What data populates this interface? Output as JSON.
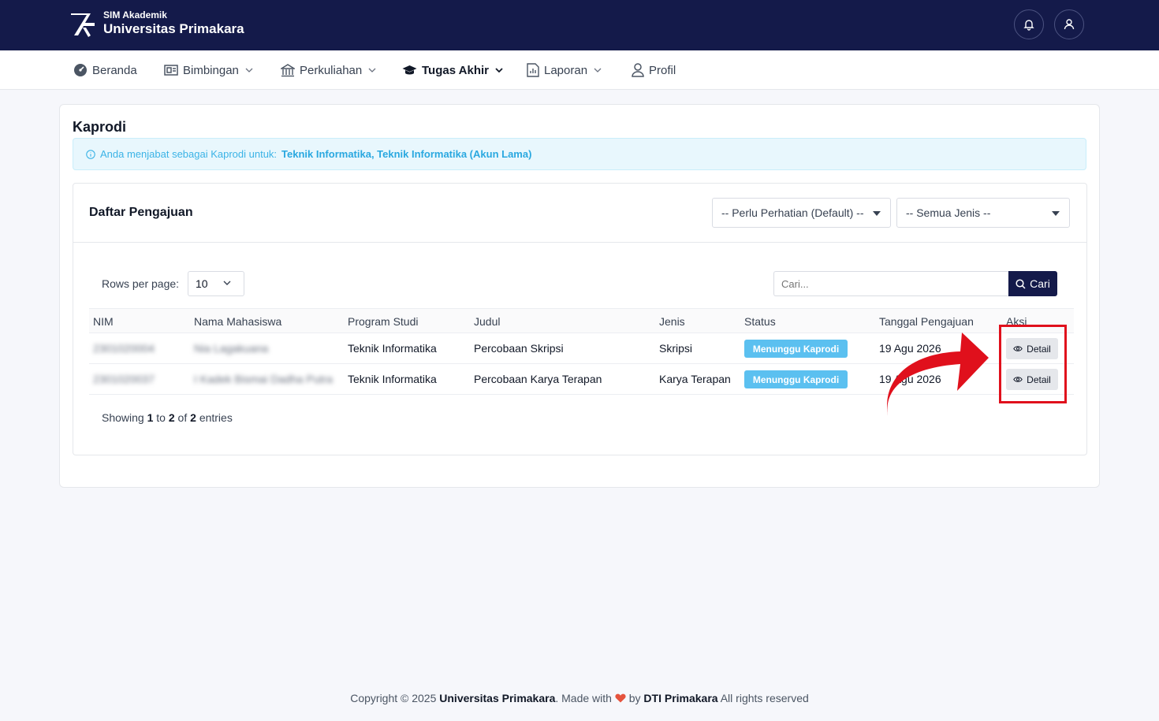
{
  "header": {
    "brand_sub": "SIM Akademik",
    "brand_main": "Universitas Primakara",
    "icons": [
      "bell-icon",
      "user-icon"
    ]
  },
  "nav": {
    "items": [
      {
        "label": "Beranda",
        "icon": "dashboard-icon"
      },
      {
        "label": "Bimbingan",
        "icon": "board-icon"
      },
      {
        "label": "Perkuliahan",
        "icon": "building-icon"
      },
      {
        "label": "Tugas Akhir",
        "icon": "graduation-cap-icon",
        "active": true
      },
      {
        "label": "Laporan",
        "icon": "report-icon"
      },
      {
        "label": "Profil",
        "icon": "user-icon"
      }
    ]
  },
  "page": {
    "title": "Kaprodi",
    "alert_prefix": "Anda menjabat sebagai Kaprodi untuk:",
    "alert_programs": "Teknik Informatika, Teknik Informatika (Akun Lama)"
  },
  "list": {
    "title": "Daftar Pengajuan",
    "filter_status": "-- Perlu Perhatian (Default) --",
    "filter_type": "-- Semua Jenis --",
    "rows_label": "Rows per page:",
    "rows_value": "10",
    "search_placeholder": "Cari...",
    "search_button": "Cari",
    "columns": [
      "NIM",
      "Nama Mahasiswa",
      "Program Studi",
      "Judul",
      "Jenis",
      "Status",
      "Tanggal Pengajuan",
      "Aksi"
    ],
    "rows": [
      {
        "nim": "2301020004",
        "nama": "Nia Lagakuana",
        "prodi": "Teknik Informatika",
        "judul": "Percobaan Skripsi",
        "jenis": "Skripsi",
        "status": "Menunggu Kaprodi",
        "tanggal": "19 Agu 2026",
        "aksi": "Detail"
      },
      {
        "nim": "2301020037",
        "nama": "I Kadek Bismai Dadha Putra",
        "prodi": "Teknik Informatika",
        "judul": "Percobaan Karya Terapan",
        "jenis": "Karya Terapan",
        "status": "Menunggu Kaprodi",
        "tanggal": "19 Agu 2026",
        "aksi": "Detail"
      }
    ],
    "showing_prefix": "Showing",
    "showing_from": "1",
    "showing_to_word": "to",
    "showing_to": "2",
    "showing_of_word": "of",
    "showing_total": "2",
    "showing_suffix": "entries"
  },
  "footer": {
    "copyright": "Copyright © 2025",
    "org": "Universitas Primakara",
    "made_with": ". Made with",
    "by": "by",
    "team": "DTI Primakara",
    "rights": "All rights reserved"
  },
  "colors": {
    "navy": "#141a4a",
    "badge": "#5bc0f0",
    "highlight": "#e0101c",
    "heart": "#e5533d"
  }
}
